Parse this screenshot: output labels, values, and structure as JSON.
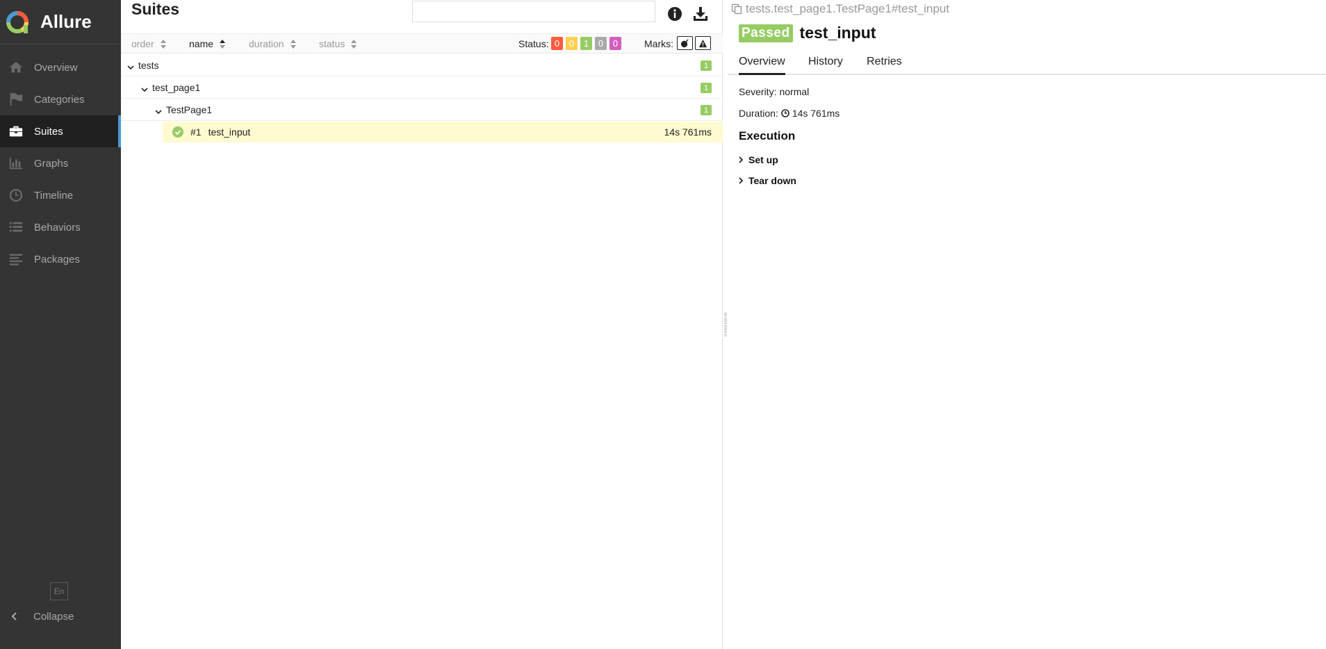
{
  "brand": {
    "name": "Allure",
    "logo_icon": "allure-logo-icon"
  },
  "sidebar": {
    "items": [
      {
        "label": "Overview",
        "icon": "home-icon",
        "active": false
      },
      {
        "label": "Categories",
        "icon": "flag-icon",
        "active": false
      },
      {
        "label": "Suites",
        "icon": "briefcase-icon",
        "active": true
      },
      {
        "label": "Graphs",
        "icon": "bar-chart-icon",
        "active": false
      },
      {
        "label": "Timeline",
        "icon": "clock-icon",
        "active": false
      },
      {
        "label": "Behaviors",
        "icon": "list-icon",
        "active": false
      },
      {
        "label": "Packages",
        "icon": "align-left-icon",
        "active": false
      }
    ],
    "language": "En",
    "collapse_label": "Collapse"
  },
  "suites_pane": {
    "title": "Suites",
    "search": {
      "value": "",
      "placeholder": ""
    },
    "sort": {
      "order": "order",
      "name": "name",
      "duration": "duration",
      "status": "status"
    },
    "status_label": "Status:",
    "status_counts": [
      {
        "value": "0",
        "color": "#fd5a3e",
        "status": "failed"
      },
      {
        "value": "0",
        "color": "#ffd050",
        "status": "broken"
      },
      {
        "value": "1",
        "color": "#97cc64",
        "status": "passed"
      },
      {
        "value": "0",
        "color": "#aaaaaa",
        "status": "skipped"
      },
      {
        "value": "0",
        "color": "#d35ebe",
        "status": "unknown"
      }
    ],
    "marks_label": "Marks:",
    "tree": [
      {
        "label": "tests",
        "count": "1"
      },
      {
        "label": "test_page1",
        "count": "1"
      },
      {
        "label": "TestPage1",
        "count": "1"
      }
    ],
    "test_case": {
      "number": "#1",
      "name": "test_input",
      "duration": "14s 761ms",
      "status": "passed"
    }
  },
  "details_pane": {
    "breadcrumb": "tests.test_page1.TestPage1#test_input",
    "status_badge": "Passed",
    "title": "test_input",
    "tabs": [
      "Overview",
      "History",
      "Retries"
    ],
    "active_tab": "Overview",
    "severity_label": "Severity:",
    "severity_value": "normal",
    "duration_label": "Duration:",
    "duration_value": "14s 761ms",
    "execution_title": "Execution",
    "steps": [
      "Set up",
      "Tear down"
    ]
  },
  "colors": {
    "sidebar_bg": "#343434",
    "accent": "#4b9ad5",
    "passed": "#97cc64",
    "selected_row": "#fffad0"
  }
}
